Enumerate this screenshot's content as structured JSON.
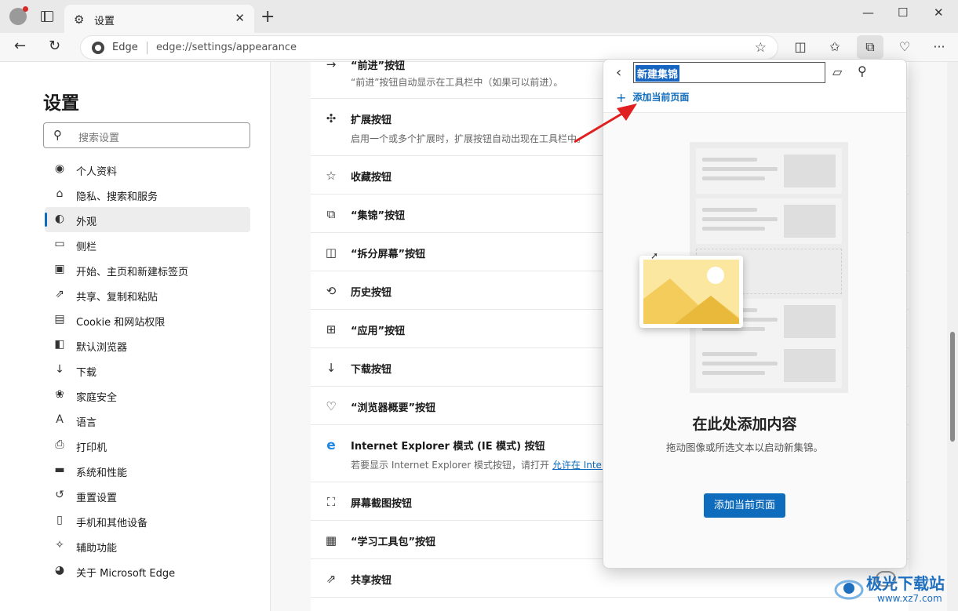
{
  "tab": {
    "title": "设置"
  },
  "address": {
    "label": "Edge",
    "url": "edge://settings/appearance"
  },
  "sidebar": {
    "title": "设置",
    "search_placeholder": "搜索设置",
    "items": [
      {
        "icon": "profile-icon",
        "label": "个人资料"
      },
      {
        "icon": "lock-icon",
        "label": "隐私、搜索和服务"
      },
      {
        "icon": "appearance-icon",
        "label": "外观",
        "active": true
      },
      {
        "icon": "sidebar-icon",
        "label": "侧栏"
      },
      {
        "icon": "home-icon",
        "label": "开始、主页和新建标签页"
      },
      {
        "icon": "share-icon",
        "label": "共享、复制和粘贴"
      },
      {
        "icon": "cookie-icon",
        "label": "Cookie 和网站权限"
      },
      {
        "icon": "browser-icon",
        "label": "默认浏览器"
      },
      {
        "icon": "download-icon",
        "label": "下载"
      },
      {
        "icon": "family-icon",
        "label": "家庭安全"
      },
      {
        "icon": "language-icon",
        "label": "语言"
      },
      {
        "icon": "printer-icon",
        "label": "打印机"
      },
      {
        "icon": "system-icon",
        "label": "系统和性能"
      },
      {
        "icon": "reset-icon",
        "label": "重置设置"
      },
      {
        "icon": "phone-icon",
        "label": "手机和其他设备"
      },
      {
        "icon": "accessibility-icon",
        "label": "辅助功能"
      },
      {
        "icon": "edge-icon",
        "label": "关于 Microsoft Edge"
      }
    ]
  },
  "settings_rows": [
    {
      "icon": "forward-icon",
      "title": "“前进”按钮",
      "desc": "“前进”按钮自动显示在工具栏中（如果可以前进）。",
      "toggle": null
    },
    {
      "icon": "extension-icon",
      "title": "扩展按钮",
      "desc": "启用一个或多个扩展时，扩展按钮自动出现在工具栏中。",
      "toggle": null
    },
    {
      "icon": "favorites-icon",
      "title": "收藏按钮",
      "desc": "",
      "toggle": true
    },
    {
      "icon": "collections-icon",
      "title": "“集锦”按钮",
      "desc": "",
      "toggle": true
    },
    {
      "icon": "split-screen-icon",
      "title": "“拆分屏幕”按钮",
      "desc": "",
      "toggle": true
    },
    {
      "icon": "history-icon",
      "title": "历史按钮",
      "desc": "",
      "toggle": false
    },
    {
      "icon": "apps-icon",
      "title": "“应用”按钮",
      "desc": "",
      "toggle": false
    },
    {
      "icon": "download-icon",
      "title": "下载按钮",
      "desc": "",
      "toggle": false
    },
    {
      "icon": "heartbeat-icon",
      "title": "“浏览器概要”按钮",
      "desc": "",
      "toggle": true
    },
    {
      "icon": "ie-icon",
      "title": "Internet Explorer 模式 (IE 模式) 按钮",
      "desc": "若要显示 Internet Explorer 模式按钮，请打开",
      "link": "允许在 Internet Explorer 模式下重新加载网站",
      "toggle": false
    },
    {
      "icon": "screenshot-icon",
      "title": "屏幕截图按钮",
      "desc": "",
      "toggle": false
    },
    {
      "icon": "learning-toolkit-icon",
      "title": "“学习工具包”按钮",
      "desc": "",
      "toggle": false
    },
    {
      "icon": "share-icon",
      "title": "共享按钮",
      "desc": "",
      "toggle": false
    }
  ],
  "collections_flyout": {
    "name": "新建集锦",
    "add_link": "添加当前页面",
    "heading": "在此处添加内容",
    "desc": "拖动图像或所选文本以启动新集锦。",
    "button": "添加当前页面"
  },
  "watermark": {
    "text": "极光下载站",
    "url": "www.xz7.com"
  },
  "colors": {
    "accent": "#0f6cbd",
    "arrow": "#e02020"
  }
}
